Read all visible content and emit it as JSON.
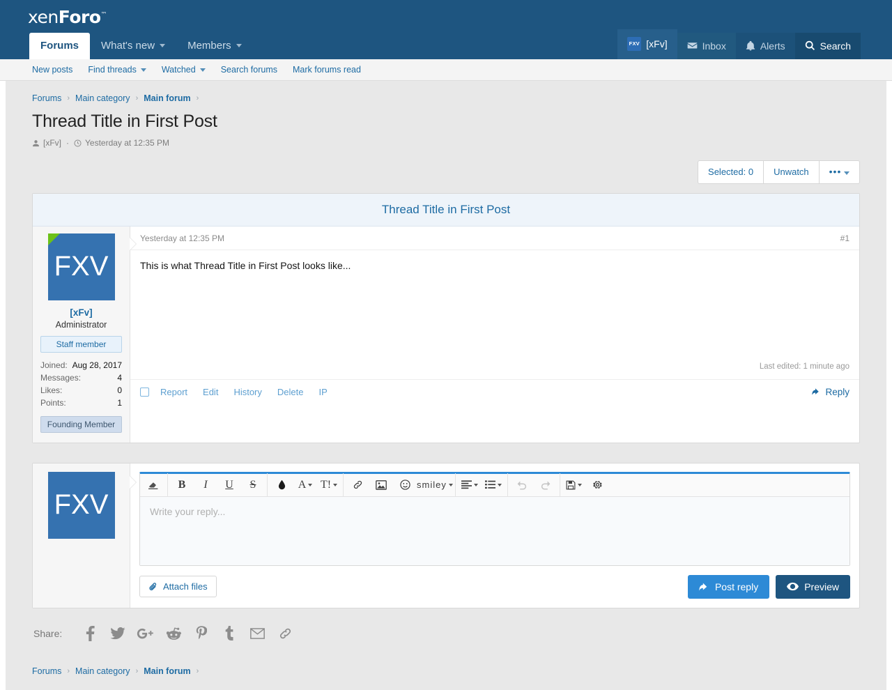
{
  "header": {
    "logo_text_a": "xen",
    "logo_text_b": "Foro",
    "logo_tm": "™",
    "nav": [
      {
        "label": "Forums",
        "icon": "",
        "has_caret": false,
        "active": true
      },
      {
        "label": "What's new",
        "icon": "",
        "has_caret": true,
        "active": false
      },
      {
        "label": "Members",
        "icon": "",
        "has_caret": true,
        "active": false
      }
    ],
    "right": [
      {
        "label": "[xFv]",
        "icon": "avatar-icon",
        "avatar_text": "FXV"
      },
      {
        "label": "Inbox",
        "icon": "envelope-icon"
      },
      {
        "label": "Alerts",
        "icon": "bell-icon"
      },
      {
        "label": "Search",
        "icon": "search-icon"
      }
    ]
  },
  "subnav": {
    "items": [
      {
        "label": "New posts",
        "has_caret": false
      },
      {
        "label": "Find threads",
        "has_caret": true
      },
      {
        "label": "Watched",
        "has_caret": true
      },
      {
        "label": "Search forums",
        "has_caret": false
      },
      {
        "label": "Mark forums read",
        "has_caret": false
      }
    ]
  },
  "breadcrumb": {
    "items": [
      {
        "label": "Forums",
        "current": false
      },
      {
        "label": "Main category",
        "current": false
      },
      {
        "label": "Main forum",
        "current": true
      }
    ],
    "separator": "›"
  },
  "thread": {
    "title": "Thread Title in First Post",
    "author": "[xFv]",
    "separator": "·",
    "timestamp": "Yesterday at 12:35 PM"
  },
  "actions": {
    "selected": "Selected: 0",
    "unwatch": "Unwatch",
    "more": "•••"
  },
  "post": {
    "block_title": "Thread Title in First Post",
    "timestamp": "Yesterday at 12:35 PM",
    "post_number": "#1",
    "body": "This is what Thread Title in First Post looks like...",
    "last_edited": "Last edited: 1 minute ago",
    "user": {
      "avatar_text": "FXV",
      "name": "[xFv]",
      "title": "Administrator",
      "staff_banner": "Staff member",
      "user_banner": "Founding Member",
      "stats": [
        {
          "label": "Joined:",
          "value": "Aug 28, 2017"
        },
        {
          "label": "Messages:",
          "value": "4"
        },
        {
          "label": "Likes:",
          "value": "0"
        },
        {
          "label": "Points:",
          "value": "1"
        }
      ]
    },
    "footer_links": [
      "Report",
      "Edit",
      "History",
      "Delete",
      "IP"
    ],
    "reply_label": "Reply"
  },
  "editor": {
    "avatar_text": "FXV",
    "placeholder": "Write your reply...",
    "toolbar": [
      {
        "name": "remove-format-icon",
        "glyph": "eraser"
      },
      {
        "sep": true
      },
      {
        "name": "bold-icon",
        "glyph": "B"
      },
      {
        "name": "italic-icon",
        "glyph": "I"
      },
      {
        "name": "underline-icon",
        "glyph": "U"
      },
      {
        "name": "strikethrough-icon",
        "glyph": "S"
      },
      {
        "sep": true
      },
      {
        "name": "text-color-icon",
        "glyph": "droplet"
      },
      {
        "name": "font-family-icon",
        "glyph": "A",
        "caret": true
      },
      {
        "name": "font-size-icon",
        "glyph": "T!",
        "caret": true
      },
      {
        "sep": true
      },
      {
        "name": "link-icon",
        "glyph": "chain"
      },
      {
        "name": "image-icon",
        "glyph": "image"
      },
      {
        "name": "smilies-icon",
        "glyph": "smiley"
      },
      {
        "name": "more-options-icon",
        "glyph": "…",
        "caret": true
      },
      {
        "sep": true
      },
      {
        "name": "text-align-icon",
        "glyph": "align",
        "caret": true
      },
      {
        "name": "list-icon",
        "glyph": "list",
        "caret": true
      },
      {
        "sep": true
      },
      {
        "name": "undo-icon",
        "glyph": "undo",
        "dim": true
      },
      {
        "name": "redo-icon",
        "glyph": "redo",
        "dim": true
      },
      {
        "sep": true
      },
      {
        "name": "drafts-icon",
        "glyph": "floppy",
        "caret": true
      },
      {
        "name": "settings-icon",
        "glyph": "gear"
      }
    ],
    "attach_label": "Attach files",
    "post_label": "Post reply",
    "preview_label": "Preview"
  },
  "share": {
    "label": "Share:",
    "icons": [
      {
        "name": "facebook-icon",
        "glyph": "f"
      },
      {
        "name": "twitter-icon",
        "glyph": "twitter"
      },
      {
        "name": "google-plus-icon",
        "glyph": "G+"
      },
      {
        "name": "reddit-icon",
        "glyph": "reddit"
      },
      {
        "name": "pinterest-icon",
        "glyph": "P"
      },
      {
        "name": "tumblr-icon",
        "glyph": "t"
      },
      {
        "name": "email-icon",
        "glyph": "envelope"
      },
      {
        "name": "link-icon",
        "glyph": "chain"
      }
    ]
  },
  "colors": {
    "header_blue": "#1e5580",
    "link_blue": "#1d6ba3",
    "accent_blue": "#2d8ad6",
    "page_bg": "#e8e8e8",
    "online_green": "#6cc118"
  }
}
